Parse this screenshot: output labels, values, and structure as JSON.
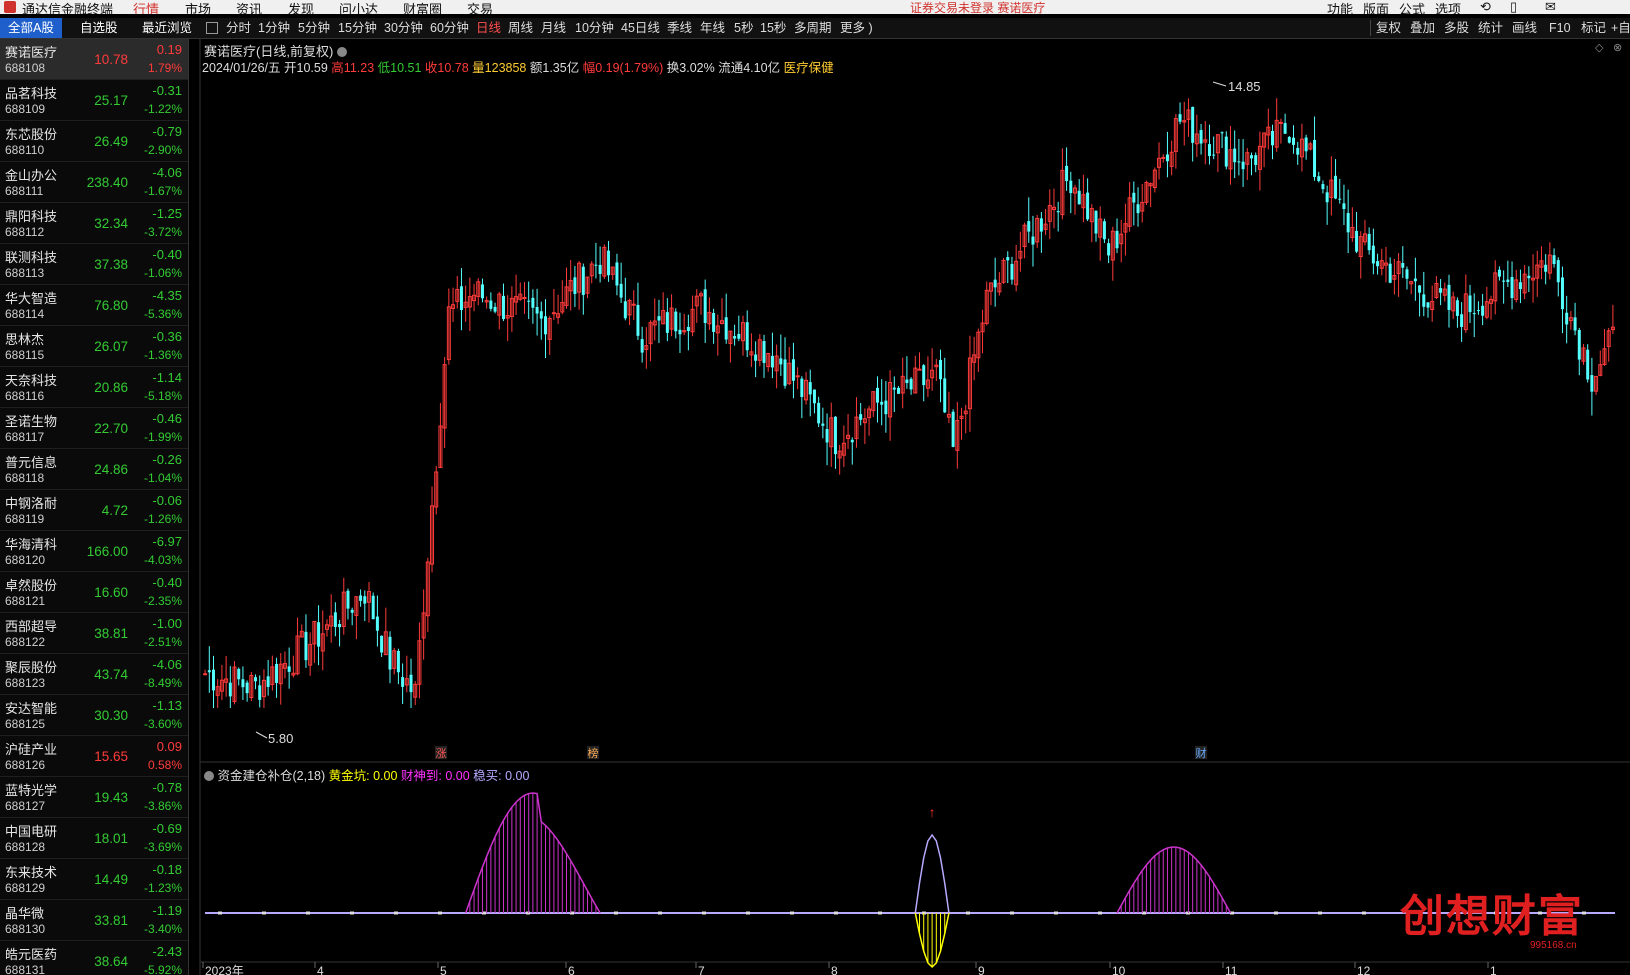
{
  "app": {
    "title": "通达信金融终端",
    "menu": [
      "行情",
      "市场",
      "资讯",
      "发现",
      "问小达",
      "财富圈",
      "交易"
    ],
    "active_menu": "行情",
    "status_text": "证券交易未登录  赛诺医疗",
    "right_menu": [
      "功能",
      "版面",
      "公式",
      "选项"
    ]
  },
  "list_tabs": [
    "全部A股",
    "自选股",
    "最近浏览"
  ],
  "periods": [
    "分时",
    "1分钟",
    "5分钟",
    "15分钟",
    "30分钟",
    "60分钟",
    "日线",
    "周线",
    "月线",
    "10分钟",
    "45日线",
    "季线",
    "年线",
    "5秒",
    "15秒",
    "多周期",
    "更多 )"
  ],
  "active_period": "日线",
  "right_tools": [
    "复权",
    "叠加",
    "多股",
    "统计",
    "画线",
    "F10",
    "标记",
    "+自"
  ],
  "stocks": [
    {
      "name": "赛诺医疗",
      "code": "688108",
      "price": "10.78",
      "chg": "0.19",
      "pct": "1.79%",
      "dir": "up"
    },
    {
      "name": "品茗科技",
      "code": "688109",
      "price": "25.17",
      "chg": "-0.31",
      "pct": "-1.22%",
      "dir": "dn"
    },
    {
      "name": "东芯股份",
      "code": "688110",
      "price": "26.49",
      "chg": "-0.79",
      "pct": "-2.90%",
      "dir": "dn"
    },
    {
      "name": "金山办公",
      "code": "688111",
      "price": "238.40",
      "chg": "-4.06",
      "pct": "-1.67%",
      "dir": "dn"
    },
    {
      "name": "鼎阳科技",
      "code": "688112",
      "price": "32.34",
      "chg": "-1.25",
      "pct": "-3.72%",
      "dir": "dn"
    },
    {
      "name": "联测科技",
      "code": "688113",
      "price": "37.38",
      "chg": "-0.40",
      "pct": "-1.06%",
      "dir": "dn"
    },
    {
      "name": "华大智造",
      "code": "688114",
      "price": "76.80",
      "chg": "-4.35",
      "pct": "-5.36%",
      "dir": "dn"
    },
    {
      "name": "思林杰",
      "code": "688115",
      "price": "26.07",
      "chg": "-0.36",
      "pct": "-1.36%",
      "dir": "dn"
    },
    {
      "name": "天奈科技",
      "code": "688116",
      "price": "20.86",
      "chg": "-1.14",
      "pct": "-5.18%",
      "dir": "dn"
    },
    {
      "name": "圣诺生物",
      "code": "688117",
      "price": "22.70",
      "chg": "-0.46",
      "pct": "-1.99%",
      "dir": "dn"
    },
    {
      "name": "普元信息",
      "code": "688118",
      "price": "24.86",
      "chg": "-0.26",
      "pct": "-1.04%",
      "dir": "dn"
    },
    {
      "name": "中钢洛耐",
      "code": "688119",
      "price": "4.72",
      "chg": "-0.06",
      "pct": "-1.26%",
      "dir": "dn"
    },
    {
      "name": "华海清科",
      "code": "688120",
      "price": "166.00",
      "chg": "-6.97",
      "pct": "-4.03%",
      "dir": "dn"
    },
    {
      "name": "卓然股份",
      "code": "688121",
      "price": "16.60",
      "chg": "-0.40",
      "pct": "-2.35%",
      "dir": "dn"
    },
    {
      "name": "西部超导",
      "code": "688122",
      "price": "38.81",
      "chg": "-1.00",
      "pct": "-2.51%",
      "dir": "dn"
    },
    {
      "name": "聚辰股份",
      "code": "688123",
      "price": "43.74",
      "chg": "-4.06",
      "pct": "-8.49%",
      "dir": "dn"
    },
    {
      "name": "安达智能",
      "code": "688125",
      "price": "30.30",
      "chg": "-1.13",
      "pct": "-3.60%",
      "dir": "dn"
    },
    {
      "name": "沪硅产业",
      "code": "688126",
      "price": "15.65",
      "chg": "0.09",
      "pct": "0.58%",
      "dir": "up"
    },
    {
      "name": "蓝特光学",
      "code": "688127",
      "price": "19.43",
      "chg": "-0.78",
      "pct": "-3.86%",
      "dir": "dn"
    },
    {
      "name": "中国电研",
      "code": "688128",
      "price": "18.01",
      "chg": "-0.69",
      "pct": "-3.69%",
      "dir": "dn"
    },
    {
      "name": "东来技术",
      "code": "688129",
      "price": "14.49",
      "chg": "-0.18",
      "pct": "-1.23%",
      "dir": "dn"
    },
    {
      "name": "晶华微",
      "code": "688130",
      "price": "33.81",
      "chg": "-1.19",
      "pct": "-3.40%",
      "dir": "dn"
    },
    {
      "name": "皓元医药",
      "code": "688131",
      "price": "38.64",
      "chg": "-2.43",
      "pct": "-5.92%",
      "dir": "dn"
    }
  ],
  "chart": {
    "title": "赛诺医疗(日线,前复权)",
    "date": "2024/01/26/五",
    "open": "开10.59",
    "high": "高11.23",
    "low": "低10.51",
    "close": "收10.78",
    "volume": "量123858",
    "amount": "额1.35亿",
    "range": "幅0.19(1.79%)",
    "turnover": "换3.02%",
    "float": "流通4.10亿",
    "sector": "医疗保健",
    "max_label": "14.85",
    "min_label": "5.80",
    "markers": [
      "涨",
      "榜",
      "财"
    ]
  },
  "indicator": {
    "name": "资金建仓补仓(2,18)",
    "g1": "黄金坑: 0.00",
    "g2": "财神到: 0.00",
    "g3": "稳买: 0.00"
  },
  "x_axis": [
    "2023年",
    "4",
    "5",
    "6",
    "7",
    "8",
    "9",
    "10",
    "11",
    "12",
    "1"
  ],
  "watermark": {
    "text": "创想财富",
    "sub": "995168.cn"
  },
  "colors": {
    "up": "#ff3b3b",
    "down": "#54ffff",
    "bg": "#000000",
    "purple": "#cc33cc",
    "yellow": "#ffff00",
    "lavender": "#b9a8ff"
  },
  "chart_data": {
    "type": "candlestick",
    "y_range": [
      5.8,
      14.85
    ],
    "price_path": [
      [
        0,
        6.3
      ],
      [
        12,
        6.1
      ],
      [
        26,
        6.8
      ],
      [
        38,
        7.5
      ],
      [
        44,
        6.5
      ],
      [
        50,
        6.0
      ],
      [
        58,
        11.5
      ],
      [
        64,
        11.8
      ],
      [
        80,
        11.4
      ],
      [
        94,
        12.3
      ],
      [
        104,
        11.2
      ],
      [
        118,
        11.6
      ],
      [
        136,
        10.9
      ],
      [
        150,
        9.7
      ],
      [
        160,
        10.2
      ],
      [
        174,
        10.6
      ],
      [
        178,
        9.5
      ],
      [
        186,
        11.7
      ],
      [
        206,
        13.5
      ],
      [
        215,
        12.4
      ],
      [
        232,
        14.3
      ],
      [
        248,
        13.7
      ],
      [
        258,
        14.2
      ],
      [
        276,
        12.4
      ],
      [
        298,
        11.5
      ],
      [
        320,
        12.3
      ],
      [
        330,
        10.6
      ],
      [
        335,
        11.1
      ]
    ],
    "indicator_humps": [
      {
        "start": 62,
        "end": 94,
        "peak": 1.0,
        "type": "purple"
      },
      {
        "start": 169,
        "end": 177,
        "peak": 0.65,
        "type": "lavender"
      },
      {
        "start": 169,
        "end": 177,
        "peak": -0.45,
        "type": "yellow"
      },
      {
        "start": 217,
        "end": 244,
        "peak": 0.55,
        "type": "purple"
      }
    ]
  }
}
